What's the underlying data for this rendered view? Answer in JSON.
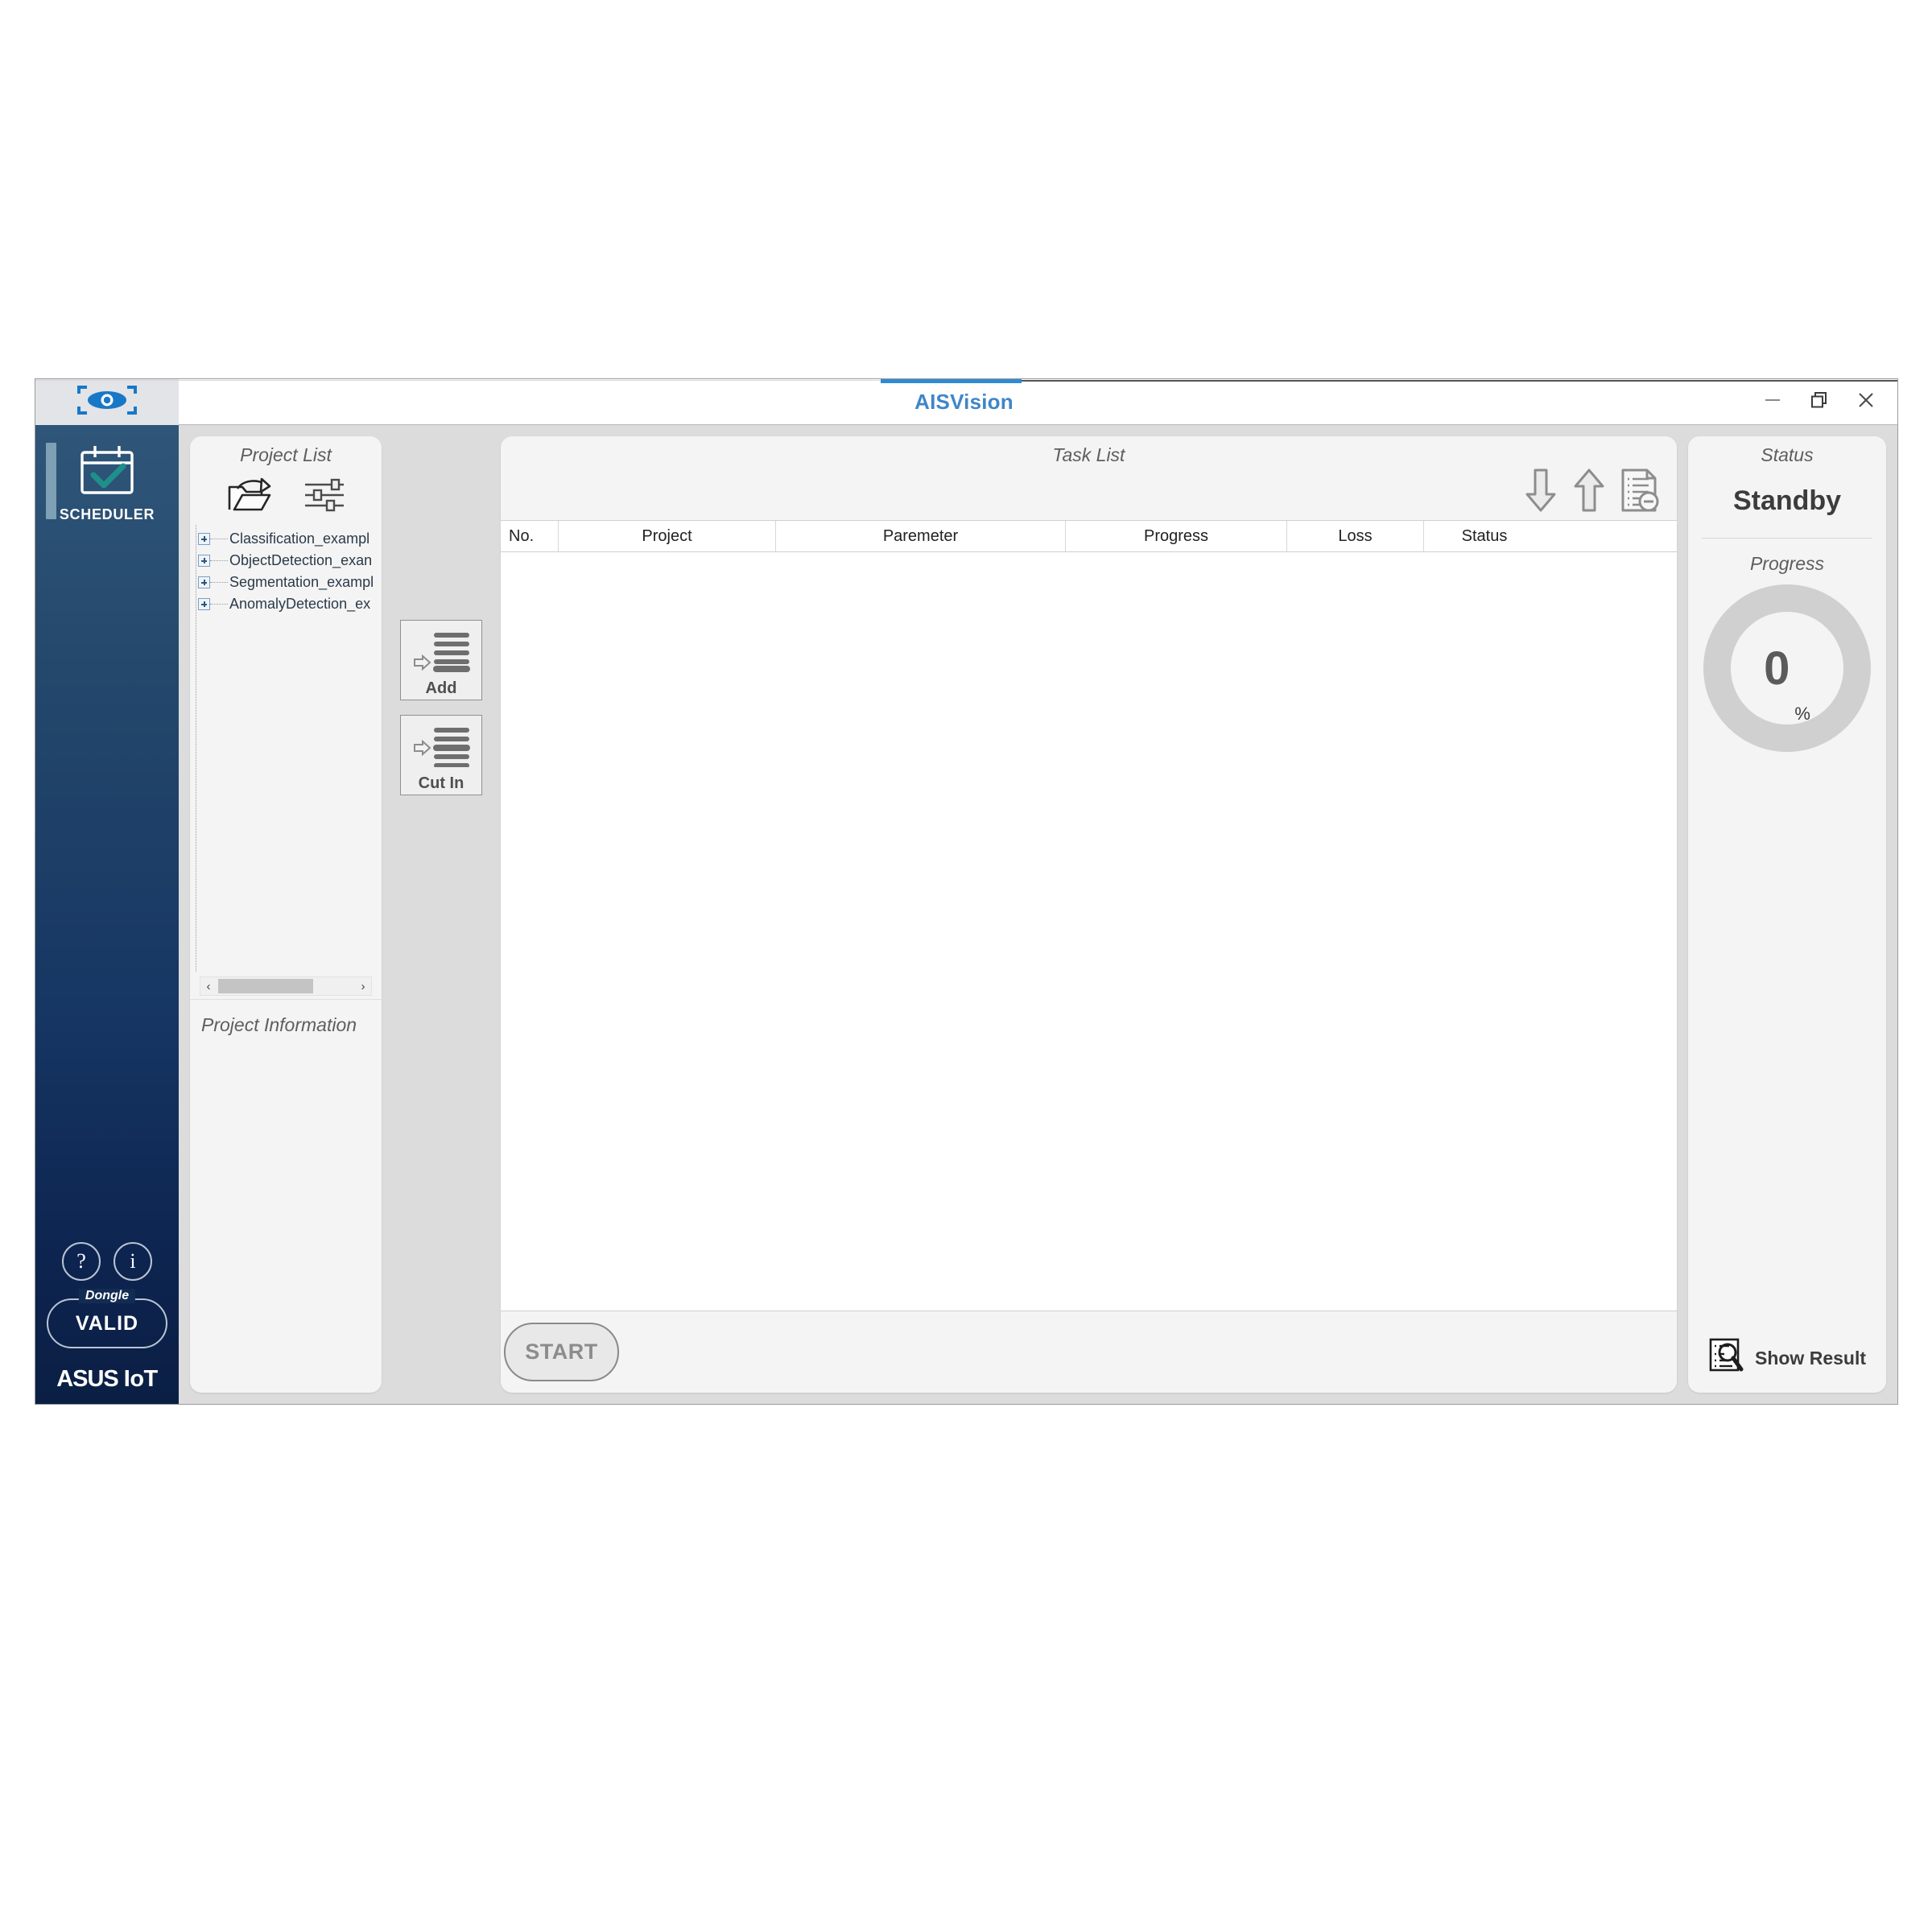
{
  "window": {
    "title": "AISVision",
    "controls": {
      "minimize": "minimize-icon",
      "restore": "restore-icon",
      "close": "close-icon"
    },
    "accent_color": "#2e8bd4",
    "title_color": "#3f86c8"
  },
  "sidebar": {
    "logo_icon": "eye-scan-icon",
    "items": [
      {
        "label": "SCHEDULER",
        "icon": "calendar-check-icon",
        "active": true
      }
    ],
    "help_button": "?",
    "info_button": "i",
    "dongle": {
      "legend": "Dongle",
      "value": "VALID"
    },
    "brand": {
      "asus": "ASUS",
      "iot": "IoT"
    },
    "gradient_top": "#2f5679",
    "gradient_bottom": "#0b1f44"
  },
  "project_list": {
    "title": "Project List",
    "icons": [
      {
        "name": "open-project-icon"
      },
      {
        "name": "settings-sliders-icon"
      }
    ],
    "items": [
      {
        "label": "Classification_exampl"
      },
      {
        "label": "ObjectDetection_exan"
      },
      {
        "label": "Segmentation_exampl"
      },
      {
        "label": "AnomalyDetection_ex"
      }
    ],
    "scrollbar": {
      "left_arrow": "‹",
      "right_arrow": "›"
    },
    "information_title": "Project Information",
    "information_body": ""
  },
  "actions": {
    "add_label": "Add",
    "cut_in_label": "Cut In"
  },
  "task_list": {
    "title": "Task List",
    "toolbar": [
      {
        "name": "move-down-icon"
      },
      {
        "name": "move-up-icon"
      },
      {
        "name": "delete-task-icon"
      }
    ],
    "columns": [
      {
        "key": "no",
        "label": "No."
      },
      {
        "key": "project",
        "label": "Project"
      },
      {
        "key": "paremeter",
        "label": "Paremeter"
      },
      {
        "key": "progress",
        "label": "Progress"
      },
      {
        "key": "loss",
        "label": "Loss"
      },
      {
        "key": "status",
        "label": "Status"
      }
    ],
    "rows": [],
    "start_label": "START"
  },
  "status_panel": {
    "title": "Status",
    "value": "Standby",
    "progress_title": "Progress",
    "progress_value": "0",
    "progress_unit": "%",
    "progress_percent": 0,
    "ring_color": "#d0d0d0",
    "show_result_label": "Show Result",
    "show_result_icon": "document-search-icon"
  }
}
